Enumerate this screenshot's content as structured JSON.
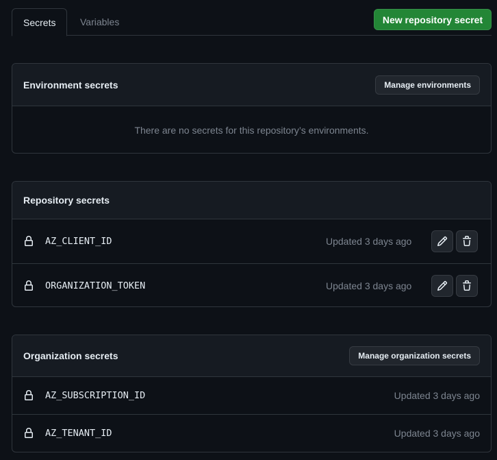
{
  "tabs": [
    {
      "label": "Secrets",
      "active": true
    },
    {
      "label": "Variables",
      "active": false
    }
  ],
  "new_secret_button": "New repository secret",
  "environment": {
    "title": "Environment secrets",
    "manage_button": "Manage environments",
    "empty_message": "There are no secrets for this repository’s environments."
  },
  "repository": {
    "title": "Repository secrets",
    "items": [
      {
        "name": "AZ_CLIENT_ID",
        "updated": "Updated 3 days ago"
      },
      {
        "name": "ORGANIZATION_TOKEN",
        "updated": "Updated 3 days ago"
      }
    ]
  },
  "organization": {
    "title": "Organization secrets",
    "manage_button": "Manage organization secrets",
    "items": [
      {
        "name": "AZ_SUBSCRIPTION_ID",
        "updated": "Updated 3 days ago"
      },
      {
        "name": "AZ_TENANT_ID",
        "updated": "Updated 3 days ago"
      }
    ]
  },
  "icons": {
    "lock": "lock-icon",
    "edit": "pencil-icon",
    "delete": "trash-icon"
  },
  "colors": {
    "background": "#0d1117",
    "header_background": "#161b22",
    "border": "#30363d",
    "primary_button": "#238636",
    "muted_text": "#7d8590"
  }
}
